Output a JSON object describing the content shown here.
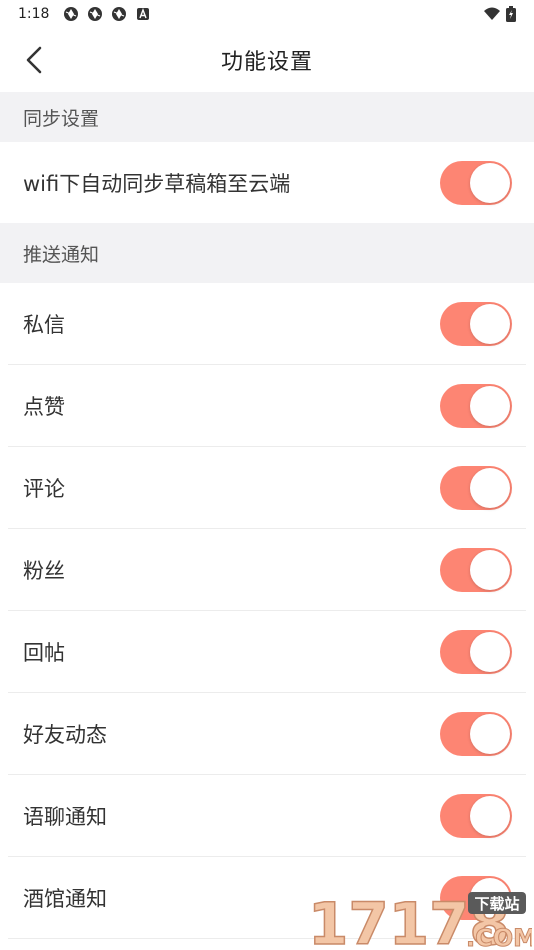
{
  "status_bar": {
    "time": "1:18",
    "left_icons": [
      "aperture-icon",
      "aperture-icon",
      "aperture-icon",
      "a-badge-icon"
    ],
    "right_icons": [
      "wifi-icon",
      "battery-icon"
    ]
  },
  "nav": {
    "title": "功能设置",
    "back_icon": "chevron-left-icon"
  },
  "sections": [
    {
      "header": "同步设置",
      "items": [
        {
          "label": "wifi下自动同步草稿箱至云端",
          "enabled": true
        }
      ]
    },
    {
      "header": "推送通知",
      "items": [
        {
          "label": "私信",
          "enabled": true
        },
        {
          "label": "点赞",
          "enabled": true
        },
        {
          "label": "评论",
          "enabled": true
        },
        {
          "label": "粉丝",
          "enabled": true
        },
        {
          "label": "回帖",
          "enabled": true
        },
        {
          "label": "好友动态",
          "enabled": true
        },
        {
          "label": "语聊通知",
          "enabled": true
        },
        {
          "label": "酒馆通知",
          "enabled": true
        }
      ]
    }
  ],
  "colors": {
    "toggle_on": "#fd8573",
    "section_bg": "#f2f2f4",
    "divider": "#ececec"
  },
  "watermark": {
    "number": "17178",
    "tag": "下载站",
    "domain": ".COM"
  }
}
